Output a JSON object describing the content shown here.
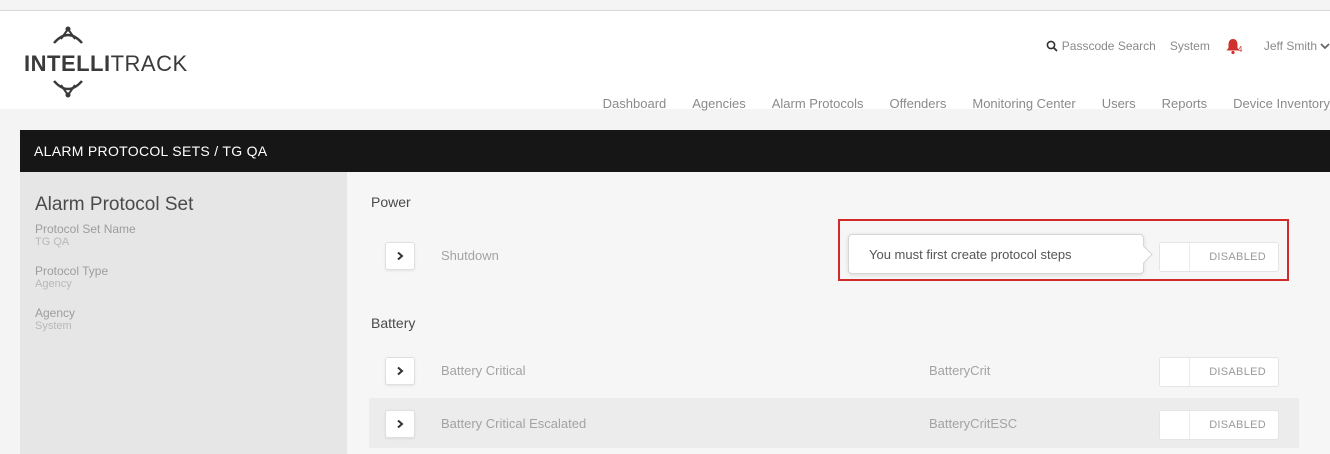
{
  "brand": {
    "logo_text_bold": "INTELLI",
    "logo_text_light": "TRACK"
  },
  "utility": {
    "passcode_search": "Passcode Search",
    "system": "System",
    "notification_count": "4",
    "user_name": "Jeff Smith"
  },
  "nav": {
    "items": [
      "Dashboard",
      "Agencies",
      "Alarm Protocols",
      "Offenders",
      "Monitoring Center",
      "Users",
      "Reports",
      "Device Inventory"
    ]
  },
  "breadcrumb": {
    "text": "ALARM PROTOCOL SETS /  TG QA"
  },
  "sidebar": {
    "title": "Alarm Protocol Set",
    "fields": [
      {
        "label": "Protocol Set Name",
        "value": "TG QA"
      },
      {
        "label": "Protocol Type",
        "value": "Agency"
      },
      {
        "label": "Agency",
        "value": "System"
      }
    ]
  },
  "main": {
    "sections": [
      {
        "title": "Power",
        "rows": [
          {
            "name": "Shutdown",
            "code": "",
            "status": "DISABLED"
          }
        ]
      },
      {
        "title": "Battery",
        "rows": [
          {
            "name": "Battery Critical",
            "code": "BatteryCrit",
            "status": "DISABLED"
          },
          {
            "name": "Battery Critical Escalated",
            "code": "BatteryCritESC",
            "status": "DISABLED"
          }
        ]
      }
    ],
    "tooltip": "You must first create protocol steps"
  },
  "colors": {
    "accent_red": "#d12a2a",
    "bar_black": "#161616",
    "sidebar_gray": "#e6e6e6"
  },
  "icons": [
    "intellitrack-logo",
    "search-icon",
    "bell-icon",
    "chevron-down-icon",
    "chevron-right-icon"
  ]
}
